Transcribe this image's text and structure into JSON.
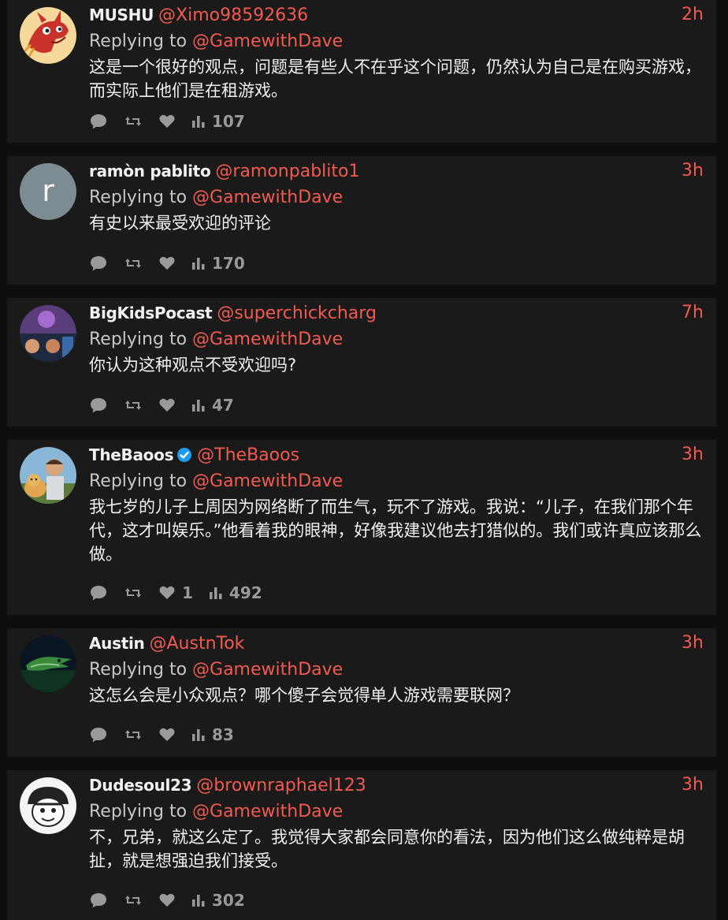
{
  "replying_label": "Replying to",
  "colors": {
    "accent": "#f25a50",
    "card": "#1a1a1a",
    "background": "#0e0e0e",
    "text": "#f0f0f0",
    "muted": "#9a9a9a"
  },
  "tweets": [
    {
      "name": "MUSHU",
      "handle": "@Ximo98592636",
      "time": "2h",
      "reply_to": "@GamewithDave",
      "text": "这是一个很好的观点，问题是有些人不在乎这个问题，仍然认为自己是在购买游戏，而实际上他们是在租游戏。",
      "likes": "",
      "views": "107",
      "verified": false,
      "avatar": "dragon-avatar"
    },
    {
      "name": "ramòn pablito",
      "handle": "@ramonpablito1",
      "time": "3h",
      "reply_to": "@GamewithDave",
      "text": "有史以来最受欢迎的评论",
      "likes": "",
      "views": "170",
      "verified": false,
      "avatar": "letter-avatar",
      "avatar_letter": "r"
    },
    {
      "name": "BigKidsPocast",
      "handle": "@superchickcharg",
      "time": "7h",
      "reply_to": "@GamewithDave",
      "text": "你认为这种观点不受欢迎吗?",
      "likes": "",
      "views": "47",
      "verified": false,
      "avatar": "collage-avatar"
    },
    {
      "name": "TheBaoos",
      "handle": "@TheBaoos",
      "time": "3h",
      "reply_to": "@GamewithDave",
      "text": "我七岁的儿子上周因为网络断了而生气，玩不了游戏。我说：“儿子，在我们那个年代，这才叫娱乐。”他看着我的眼神，好像我建议他去打猎似的。我们或许真应该那么做。",
      "likes": "1",
      "views": "492",
      "verified": true,
      "avatar": "man-dog-avatar"
    },
    {
      "name": "Austin",
      "handle": "@AustnTok",
      "time": "3h",
      "reply_to": "@GamewithDave",
      "text": "这怎么会是小众观点？哪个傻子会觉得单人游戏需要联网？",
      "likes": "",
      "views": "83",
      "verified": false,
      "avatar": "seahawks-avatar"
    },
    {
      "name": "Dudesoul23",
      "handle": "@brownraphael123",
      "time": "3h",
      "reply_to": "@GamewithDave",
      "text": "不，兄弟，就这么定了。我觉得大家都会同意你的看法，因为他们这么做纯粹是胡扯，就是想强迫我们接受。",
      "likes": "",
      "views": "302",
      "verified": false,
      "avatar": "manga-avatar"
    }
  ]
}
